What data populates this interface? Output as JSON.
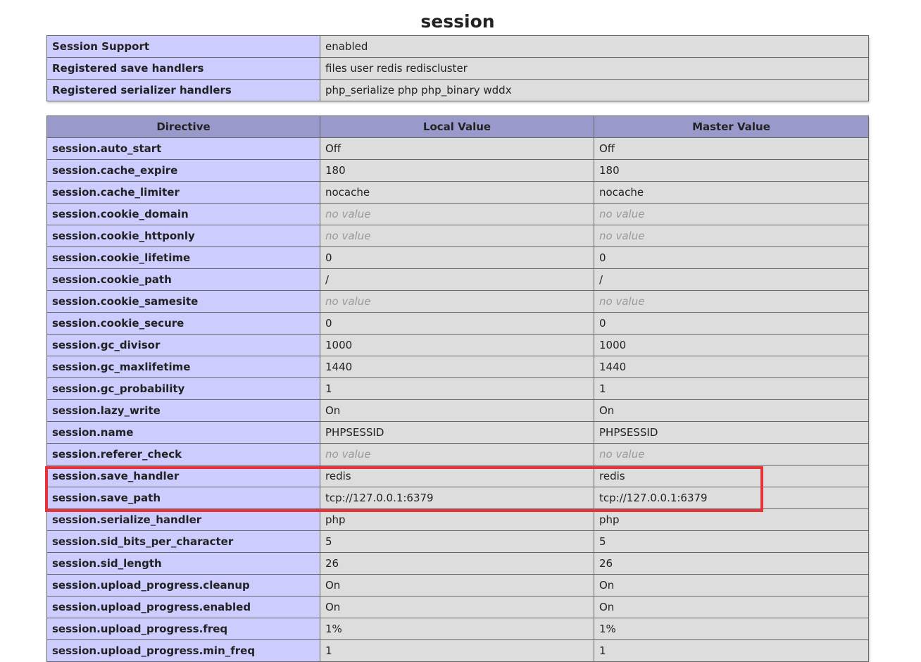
{
  "page": {
    "title": "session"
  },
  "support_table": {
    "rows": [
      {
        "key": "Session Support",
        "value": "enabled"
      },
      {
        "key": "Registered save handlers",
        "value": "files user redis rediscluster"
      },
      {
        "key": "Registered serializer handlers",
        "value": "php_serialize php php_binary wddx"
      }
    ]
  },
  "directive_table": {
    "headers": {
      "directive": "Directive",
      "local": "Local Value",
      "master": "Master Value"
    },
    "no_value_text": "no value",
    "rows": [
      {
        "name": "session.auto_start",
        "local": "Off",
        "master": "Off"
      },
      {
        "name": "session.cache_expire",
        "local": "180",
        "master": "180"
      },
      {
        "name": "session.cache_limiter",
        "local": "nocache",
        "master": "nocache"
      },
      {
        "name": "session.cookie_domain",
        "local": "no value",
        "master": "no value"
      },
      {
        "name": "session.cookie_httponly",
        "local": "no value",
        "master": "no value"
      },
      {
        "name": "session.cookie_lifetime",
        "local": "0",
        "master": "0"
      },
      {
        "name": "session.cookie_path",
        "local": "/",
        "master": "/"
      },
      {
        "name": "session.cookie_samesite",
        "local": "no value",
        "master": "no value"
      },
      {
        "name": "session.cookie_secure",
        "local": "0",
        "master": "0"
      },
      {
        "name": "session.gc_divisor",
        "local": "1000",
        "master": "1000"
      },
      {
        "name": "session.gc_maxlifetime",
        "local": "1440",
        "master": "1440"
      },
      {
        "name": "session.gc_probability",
        "local": "1",
        "master": "1"
      },
      {
        "name": "session.lazy_write",
        "local": "On",
        "master": "On"
      },
      {
        "name": "session.name",
        "local": "PHPSESSID",
        "master": "PHPSESSID"
      },
      {
        "name": "session.referer_check",
        "local": "no value",
        "master": "no value"
      },
      {
        "name": "session.save_handler",
        "local": "redis",
        "master": "redis"
      },
      {
        "name": "session.save_path",
        "local": "tcp://127.0.0.1:6379",
        "master": "tcp://127.0.0.1:6379"
      },
      {
        "name": "session.serialize_handler",
        "local": "php",
        "master": "php"
      },
      {
        "name": "session.sid_bits_per_character",
        "local": "5",
        "master": "5"
      },
      {
        "name": "session.sid_length",
        "local": "26",
        "master": "26"
      },
      {
        "name": "session.upload_progress.cleanup",
        "local": "On",
        "master": "On"
      },
      {
        "name": "session.upload_progress.enabled",
        "local": "On",
        "master": "On"
      },
      {
        "name": "session.upload_progress.freq",
        "local": "1%",
        "master": "1%"
      },
      {
        "name": "session.upload_progress.min_freq",
        "local": "1",
        "master": "1"
      }
    ]
  },
  "colors": {
    "header_bg": "#9999cc",
    "key_bg": "#ccccff",
    "value_bg": "#dddddd",
    "border": "#666666",
    "no_value_text": "#999999",
    "highlight": "#e8323a"
  }
}
